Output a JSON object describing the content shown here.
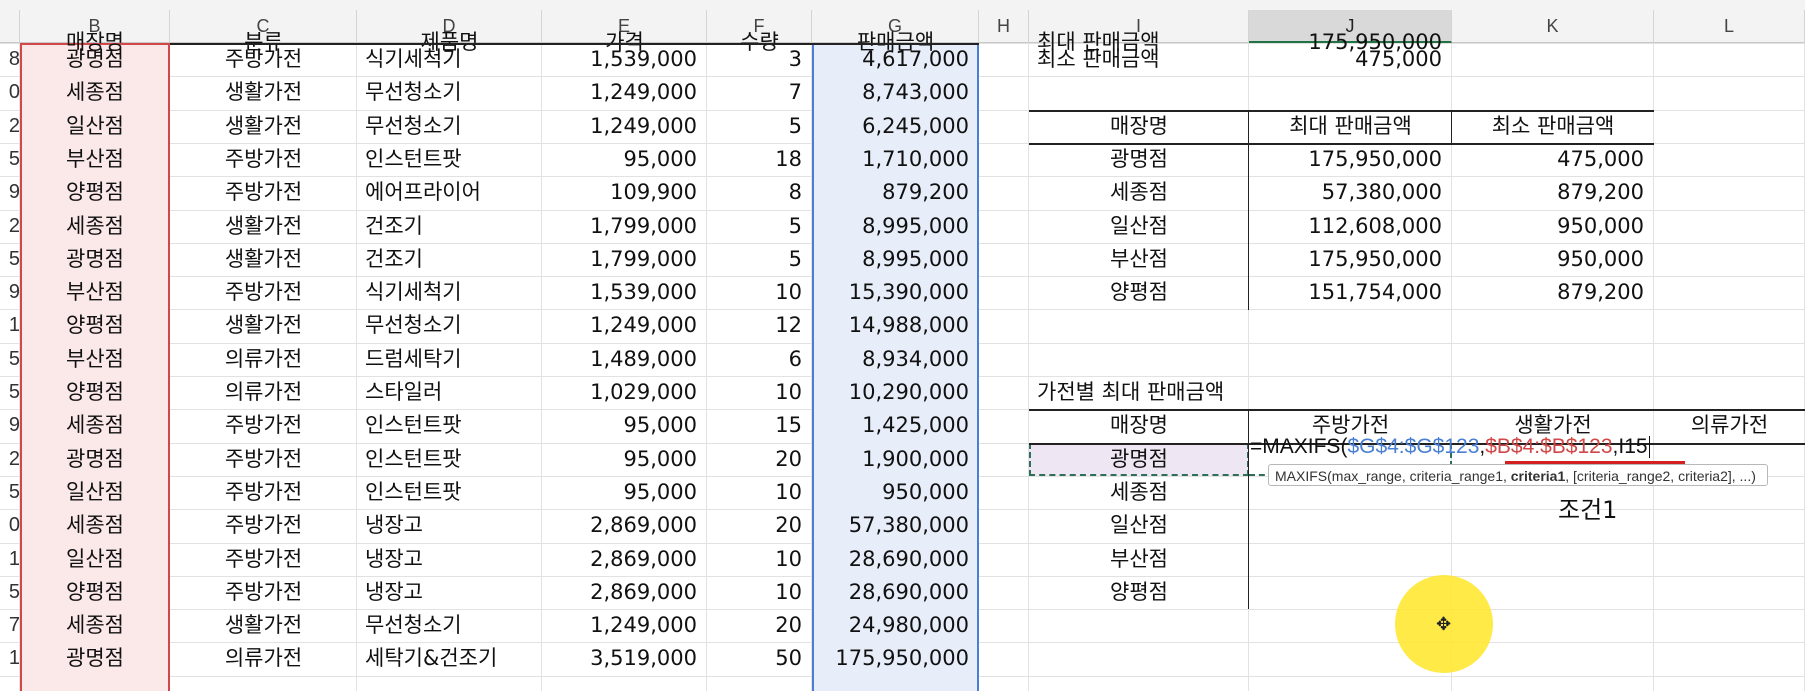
{
  "columns": {
    "B": "B",
    "C": "C",
    "D": "D",
    "E": "E",
    "F": "F",
    "G": "G",
    "H": "H",
    "I": "I",
    "J": "J",
    "K": "K",
    "L": "L"
  },
  "top_partial": {
    "b": "매장명",
    "c": "분류",
    "d": "제품명",
    "e": "가격",
    "f": "수량",
    "g": "판매금액",
    "i": "최대 판매금액",
    "j": "175,950,000"
  },
  "row_numbers": [
    "8",
    "0",
    "2",
    "5",
    "9",
    "2",
    "5",
    "9",
    "1",
    "5",
    "5",
    "9",
    "2",
    "5",
    "0",
    "1",
    "5",
    "7",
    "1"
  ],
  "data_rows": [
    {
      "store": "광명점",
      "cat": "주방가전",
      "product": "식기세척기",
      "price": "1,539,000",
      "qty": "3",
      "amount": "4,617,000"
    },
    {
      "store": "세종점",
      "cat": "생활가전",
      "product": "무선청소기",
      "price": "1,249,000",
      "qty": "7",
      "amount": "8,743,000"
    },
    {
      "store": "일산점",
      "cat": "생활가전",
      "product": "무선청소기",
      "price": "1,249,000",
      "qty": "5",
      "amount": "6,245,000"
    },
    {
      "store": "부산점",
      "cat": "주방가전",
      "product": "인스턴트팟",
      "price": "95,000",
      "qty": "18",
      "amount": "1,710,000"
    },
    {
      "store": "양평점",
      "cat": "주방가전",
      "product": "에어프라이어",
      "price": "109,900",
      "qty": "8",
      "amount": "879,200"
    },
    {
      "store": "세종점",
      "cat": "생활가전",
      "product": "건조기",
      "price": "1,799,000",
      "qty": "5",
      "amount": "8,995,000"
    },
    {
      "store": "광명점",
      "cat": "생활가전",
      "product": "건조기",
      "price": "1,799,000",
      "qty": "5",
      "amount": "8,995,000"
    },
    {
      "store": "부산점",
      "cat": "주방가전",
      "product": "식기세척기",
      "price": "1,539,000",
      "qty": "10",
      "amount": "15,390,000"
    },
    {
      "store": "양평점",
      "cat": "생활가전",
      "product": "무선청소기",
      "price": "1,249,000",
      "qty": "12",
      "amount": "14,988,000"
    },
    {
      "store": "부산점",
      "cat": "의류가전",
      "product": "드럼세탁기",
      "price": "1,489,000",
      "qty": "6",
      "amount": "8,934,000"
    },
    {
      "store": "양평점",
      "cat": "의류가전",
      "product": "스타일러",
      "price": "1,029,000",
      "qty": "10",
      "amount": "10,290,000"
    },
    {
      "store": "세종점",
      "cat": "주방가전",
      "product": "인스턴트팟",
      "price": "95,000",
      "qty": "15",
      "amount": "1,425,000"
    },
    {
      "store": "광명점",
      "cat": "주방가전",
      "product": "인스턴트팟",
      "price": "95,000",
      "qty": "20",
      "amount": "1,900,000"
    },
    {
      "store": "일산점",
      "cat": "주방가전",
      "product": "인스턴트팟",
      "price": "95,000",
      "qty": "10",
      "amount": "950,000"
    },
    {
      "store": "세종점",
      "cat": "주방가전",
      "product": "냉장고",
      "price": "2,869,000",
      "qty": "20",
      "amount": "57,380,000"
    },
    {
      "store": "일산점",
      "cat": "주방가전",
      "product": "냉장고",
      "price": "2,869,000",
      "qty": "10",
      "amount": "28,690,000"
    },
    {
      "store": "양평점",
      "cat": "주방가전",
      "product": "냉장고",
      "price": "2,869,000",
      "qty": "10",
      "amount": "28,690,000"
    },
    {
      "store": "세종점",
      "cat": "생활가전",
      "product": "무선청소기",
      "price": "1,249,000",
      "qty": "20",
      "amount": "24,980,000"
    },
    {
      "store": "광명점",
      "cat": "의류가전",
      "product": "세탁기&건조기",
      "price": "3,519,000",
      "qty": "50",
      "amount": "175,950,000"
    }
  ],
  "min_total": {
    "label": "최소 판매금액",
    "value": "475,000"
  },
  "store_table": {
    "headers": [
      "매장명",
      "최대 판매금액",
      "최소 판매금액"
    ],
    "rows": [
      [
        "광명점",
        "175,950,000",
        "475,000"
      ],
      [
        "세종점",
        "57,380,000",
        "879,200"
      ],
      [
        "일산점",
        "112,608,000",
        "950,000"
      ],
      [
        "부산점",
        "175,950,000",
        "950,000"
      ],
      [
        "양평점",
        "151,754,000",
        "879,200"
      ]
    ]
  },
  "category_table": {
    "title": "가전별 최대 판매금액",
    "headers": [
      "매장명",
      "주방가전",
      "생활가전",
      "의류가전"
    ],
    "stores": [
      "광명점",
      "세종점",
      "일산점",
      "부산점",
      "양평점"
    ]
  },
  "formula": {
    "prefix": "=MAXIFS(",
    "arg1": "$G$4:$G$123",
    "sep1": ",",
    "arg2": "$B$4:$B$123",
    "sep2": ",",
    "arg3": "I15",
    "tooltip_fn": "MAXIFS(max_range, criteria_range1, ",
    "tooltip_bold": "criteria1",
    "tooltip_rest": ", [criteria_range2, criteria2], ...)"
  },
  "caption": "조건1",
  "colors": {
    "blue_ref": "#4a7fd4",
    "red_ref": "#d04848",
    "blue_fill": "#e8eef9",
    "red_fill": "#fbe9ea",
    "purple_fill": "#efe6f3"
  }
}
